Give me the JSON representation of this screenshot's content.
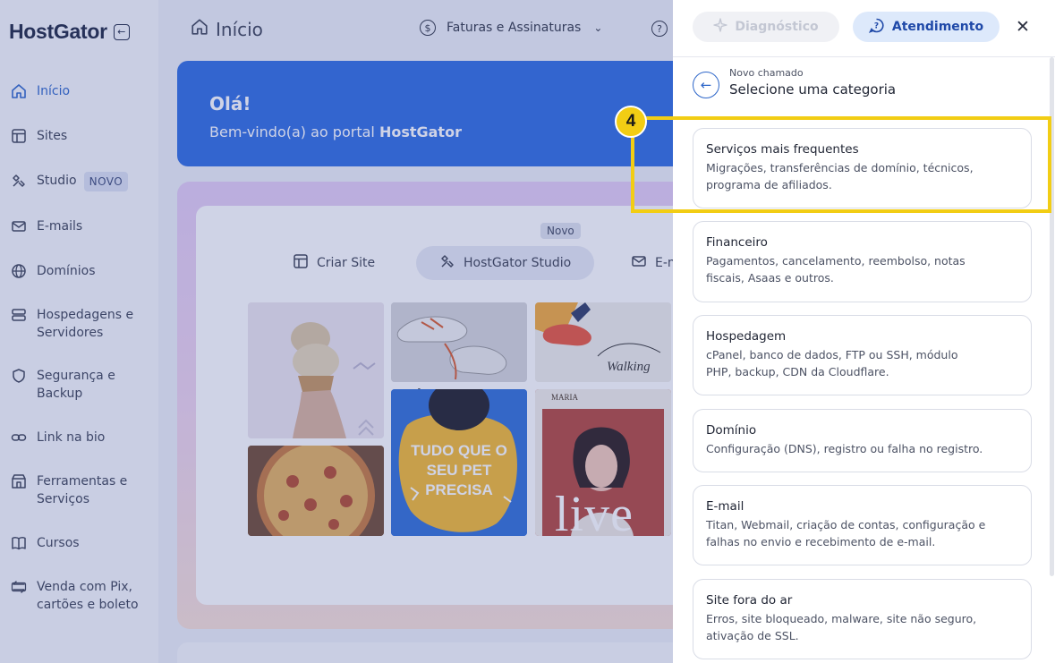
{
  "brand": {
    "name": "HostGator",
    "collapse_icon": "collapse-sidebar-icon"
  },
  "sidebar": {
    "items": [
      {
        "id": "inicio",
        "label": "Início",
        "icon": "home-icon",
        "active": true
      },
      {
        "id": "sites",
        "label": "Sites",
        "icon": "layout-icon"
      },
      {
        "id": "studio",
        "label": "Studio",
        "icon": "studio-icon",
        "badge": "NOVO"
      },
      {
        "id": "emails",
        "label": "E-mails",
        "icon": "mail-icon"
      },
      {
        "id": "dominios",
        "label": "Domínios",
        "icon": "globe-icon"
      },
      {
        "id": "hospedagens",
        "label": "Hospedagens e",
        "label2": "Servidores",
        "icon": "server-icon"
      },
      {
        "id": "seguranca",
        "label": "Segurança e",
        "label2": "Backup",
        "icon": "shield-icon"
      },
      {
        "id": "linkbio",
        "label": "Link na bio",
        "icon": "link-icon"
      },
      {
        "id": "ferramentas",
        "label": "Ferramentas e",
        "label2": "Serviços",
        "icon": "store-icon"
      },
      {
        "id": "cursos",
        "label": "Cursos",
        "icon": "book-icon"
      },
      {
        "id": "pix",
        "label": "Venda com Pix,",
        "label2": "cartões e boleto",
        "icon": "payment-icon"
      }
    ]
  },
  "topbar": {
    "title": "Início",
    "invoices_label": "Faturas e Assinaturas"
  },
  "hero": {
    "greeting": "Olá!",
    "welcome_prefix": "Bem-vindo(a) ao portal ",
    "welcome_brand": "HostGator"
  },
  "features": {
    "tabs": [
      {
        "label": "Criar Site",
        "icon": "layout-icon"
      },
      {
        "label": "HostGator Studio",
        "icon": "studio-icon",
        "selected": true
      },
      {
        "label": "E-m",
        "icon": "mail-icon"
      }
    ],
    "novo_tag": "Novo",
    "thumbnails": {
      "pet_line1": "TUDO QUE O",
      "pet_line2": "SEU PET",
      "pet_line3": "PRECISA",
      "live": "live",
      "maria": "MARIA",
      "walking": "Walking"
    }
  },
  "panel": {
    "diagnostic_label": "Diagnóstico",
    "support_label": "Atendimento",
    "breadcrumb": "Novo chamado",
    "title": "Selecione uma categoria",
    "step_number": "4",
    "categories": [
      {
        "title": "Serviços mais frequentes",
        "desc1": "Migrações, transferências de domínio, técnicos,",
        "desc2": "programa de afiliados."
      },
      {
        "title": "Financeiro",
        "desc1": "Pagamentos, cancelamento, reembolso, notas",
        "desc2": "fiscais, Asaas e outros."
      },
      {
        "title": "Hospedagem",
        "desc1": "cPanel, banco de dados, FTP ou SSH, módulo",
        "desc2": "PHP, backup, CDN da Cloudflare."
      },
      {
        "title": "Domínio",
        "desc1": "Configuração (DNS), registro ou falha no registro.",
        "desc2": ""
      },
      {
        "title": "E-mail",
        "desc1": "Titan, Webmail, criação de contas, configuração e",
        "desc2": "falhas no envio e recebimento de e-mail."
      },
      {
        "title": "Site fora do ar",
        "desc1": "Erros, site bloqueado, malware, site não seguro,",
        "desc2": "ativação de SSL."
      }
    ]
  },
  "colors": {
    "accent": "#2d66c9",
    "hero": "#2d6be0",
    "highlight": "#f2cd14"
  }
}
